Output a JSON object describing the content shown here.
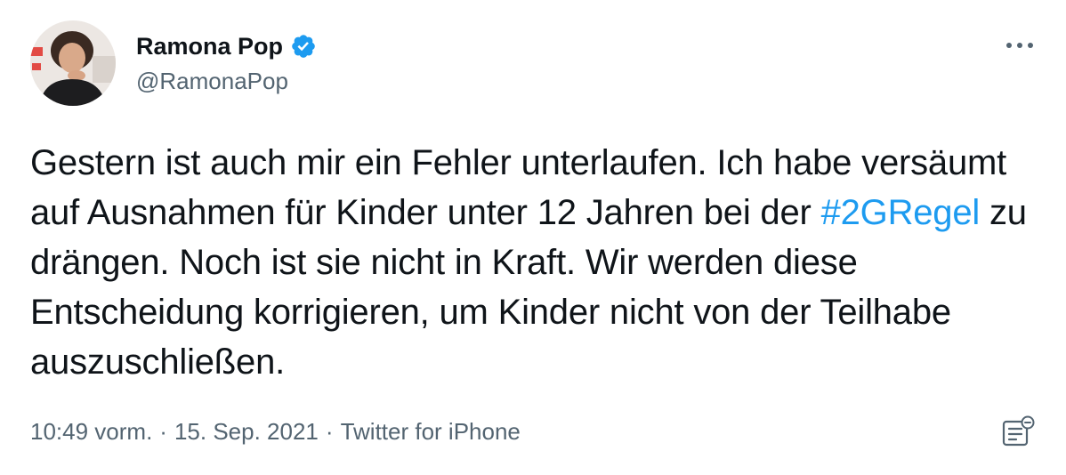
{
  "author": {
    "display_name": "Ramona Pop",
    "handle": "@RamonaPop",
    "verified": true
  },
  "tweet": {
    "text_before": "Gestern ist auch mir ein Fehler unterlaufen. Ich habe versäumt auf Ausnahmen für Kinder unter 12 Jahren bei der ",
    "hashtag": "#2GRegel",
    "text_after": " zu drängen. Noch ist sie nicht in Kraft. Wir werden diese Entscheidung korrigieren, um Kinder nicht von der Teilhabe auszuschließen."
  },
  "meta": {
    "time": "10:49 vorm.",
    "separator": "·",
    "date": "15. Sep. 2021",
    "source": "Twitter for iPhone"
  },
  "icons": {
    "verified": "verified-badge-icon",
    "more": "more-options-icon",
    "analytics": "tweet-analytics-icon"
  },
  "colors": {
    "link": "#1d9bf0",
    "secondary_text": "#536471",
    "primary_text": "#0f1419"
  }
}
